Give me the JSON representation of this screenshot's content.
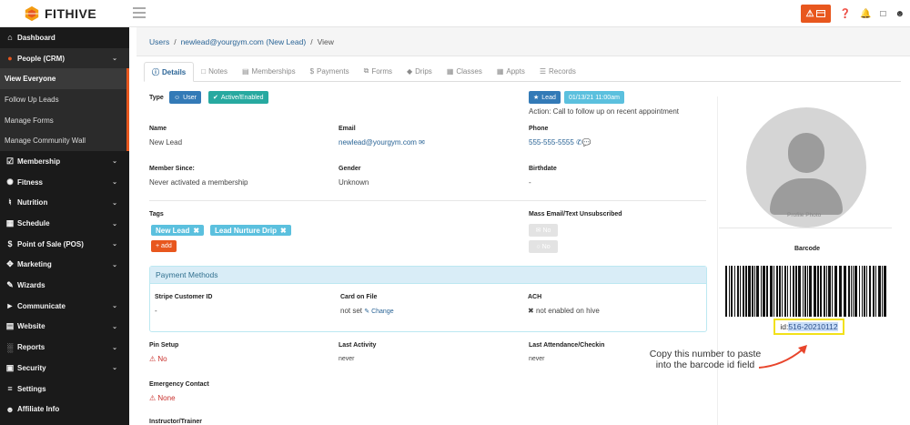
{
  "app": {
    "brand": "FITHIVE",
    "colors": {
      "accent": "#e8571e",
      "primary": "#337ab7",
      "teal": "#27a9a0",
      "info": "#5bc0de",
      "sidebar": "#1a1a1a"
    }
  },
  "topbar": {
    "alert_icon": "warning-icon",
    "help_icon": "?",
    "bell_icon": "bell-icon",
    "phone_icon": "phone-icon",
    "user_icon": "user-icon"
  },
  "sidebar": {
    "items": [
      {
        "label": "Dashboard",
        "icon": "⌂"
      },
      {
        "label": "People (CRM)",
        "icon": "👥"
      },
      {
        "label": "View Everyone"
      },
      {
        "label": "Follow Up Leads"
      },
      {
        "label": "Manage Forms"
      },
      {
        "label": "Manage Community Wall"
      },
      {
        "label": "Membership",
        "icon": "☑"
      },
      {
        "label": "Fitness",
        "icon": "⚙"
      },
      {
        "label": "Nutrition",
        "icon": "🍴"
      },
      {
        "label": "Schedule",
        "icon": "▦"
      },
      {
        "label": "Point of Sale (POS)",
        "icon": "$"
      },
      {
        "label": "Marketing",
        "icon": "✥"
      },
      {
        "label": "Wizards",
        "icon": "✎"
      },
      {
        "label": "Communicate",
        "icon": "📣"
      },
      {
        "label": "Website",
        "icon": "🗎"
      },
      {
        "label": "Reports",
        "icon": "📊"
      },
      {
        "label": "Security",
        "icon": "🔒"
      },
      {
        "label": "Settings",
        "icon": "☰"
      },
      {
        "label": "Affiliate Info",
        "icon": "👤"
      }
    ]
  },
  "breadcrumb": {
    "users": "Users",
    "sep1": "/",
    "person": "newlead@yourgym.com (New Lead)",
    "sep2": "/",
    "current": "View"
  },
  "tabs": [
    {
      "label": "Details"
    },
    {
      "label": "Notes"
    },
    {
      "label": "Memberships"
    },
    {
      "label": "Payments"
    },
    {
      "label": "Forms"
    },
    {
      "label": "Drips"
    },
    {
      "label": "Classes"
    },
    {
      "label": "Appts"
    },
    {
      "label": "Records"
    }
  ],
  "details": {
    "type_label": "Type",
    "user_btn": "User",
    "active_btn": "Active/Enabled",
    "lead_btn": "Lead",
    "lead_date": "01/13/21 11:00am",
    "action": "Action: Call to follow up on recent appointment",
    "name_label": "Name",
    "name": "New Lead",
    "email_label": "Email",
    "email": "newlead@yourgym.com",
    "phone_label": "Phone",
    "phone": "555-555-5555",
    "member_since_label": "Member Since:",
    "member_since": "Never activated a membership",
    "gender_label": "Gender",
    "gender": "Unknown",
    "birthdate_label": "Birthdate",
    "birthdate": "-",
    "tags_label": "Tags",
    "tags": [
      "New Lead",
      "Lead Nurture Drip"
    ],
    "add_tag": "+ add",
    "unsub_label": "Mass Email/Text Unsubscribed",
    "unsub_email": "No",
    "unsub_text": "No",
    "payment_methods": "Payment Methods",
    "stripe_label": "Stripe Customer ID",
    "stripe": "-",
    "card_label": "Card on File",
    "card": "not set",
    "change": "Change",
    "ach_label": "ACH",
    "ach": "not enabled on hive",
    "pin_label": "Pin Setup",
    "pin": "No",
    "last_activity_label": "Last Activity",
    "last_activity": "never",
    "last_attendance_label": "Last Attendance/Checkin",
    "last_attendance": "never",
    "emergency_label": "Emergency Contact",
    "emergency": "None",
    "instructor_label": "Instructor/Trainer"
  },
  "profile": {
    "caption": "Profile Photo",
    "barcode_label": "Barcode",
    "id_prefix": "id:",
    "id_value": "516-20210112"
  },
  "annotation": {
    "text": "Copy this number to paste into the barcode id field"
  }
}
